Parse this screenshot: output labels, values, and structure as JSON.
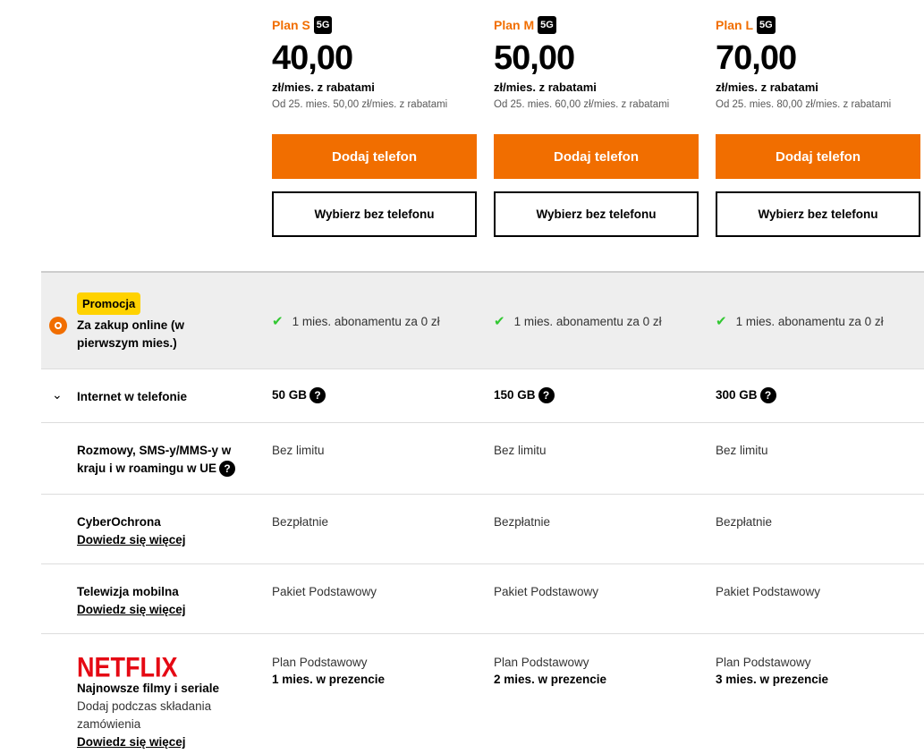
{
  "plans": [
    {
      "name": "Plan S",
      "badge": "5G",
      "price": "40,00",
      "unit": "zł/mies. z rabatami",
      "later": "Od 25. mies. 50,00 zł/mies. z rabatami",
      "primary": "Dodaj telefon",
      "secondary": "Wybierz bez telefonu"
    },
    {
      "name": "Plan M",
      "badge": "5G",
      "price": "50,00",
      "unit": "zł/mies. z rabatami",
      "later": "Od 25. mies. 60,00 zł/mies. z rabatami",
      "primary": "Dodaj telefon",
      "secondary": "Wybierz bez telefonu"
    },
    {
      "name": "Plan L",
      "badge": "5G",
      "price": "70,00",
      "unit": "zł/mies. z rabatami",
      "later": "Od 25. mies. 80,00 zł/mies. z rabatami",
      "primary": "Dodaj telefon",
      "secondary": "Wybierz bez telefonu"
    }
  ],
  "rows": {
    "promo": {
      "badge": "Promocja",
      "label": "Za zakup online (w pierwszym mies.)",
      "values": [
        "1 mies. abonamentu za 0 zł",
        "1 mies. abonamentu za 0 zł",
        "1 mies. abonamentu za 0 zł"
      ],
      "icon": "promo-icon"
    },
    "internet": {
      "label": "Internet w telefonie",
      "values": [
        "50 GB",
        "150 GB",
        "300 GB"
      ],
      "help": "?"
    },
    "calls": {
      "label": "Rozmowy, SMS-y/MMS-y w kraju i w roamingu w UE",
      "values": [
        "Bez limitu",
        "Bez limitu",
        "Bez limitu"
      ],
      "help": "?"
    },
    "cyber": {
      "label": "CyberOchrona",
      "link": "Dowiedz się więcej",
      "values": [
        "Bezpłatnie",
        "Bezpłatnie",
        "Bezpłatnie"
      ]
    },
    "tv": {
      "label": "Telewizja mobilna",
      "link": "Dowiedz się więcej",
      "values": [
        "Pakiet Podstawowy",
        "Pakiet Podstawowy",
        "Pakiet Podstawowy"
      ]
    },
    "netflix": {
      "logo": "NETFLIX",
      "label": "Najnowsze filmy i seriale",
      "sub": "Dodaj podczas składania zamówienia",
      "link": "Dowiedz się więcej",
      "values": [
        "Plan Podstawowy",
        "Plan Podstawowy",
        "Plan Podstawowy"
      ],
      "values2": [
        "1 mies. w prezencie",
        "2 mies. w prezencie",
        "3 mies. w prezencie"
      ]
    }
  },
  "colors": {
    "accent": "#f16e00",
    "promo": "#ffd200",
    "check": "#32c832",
    "netflix": "#e50914"
  }
}
